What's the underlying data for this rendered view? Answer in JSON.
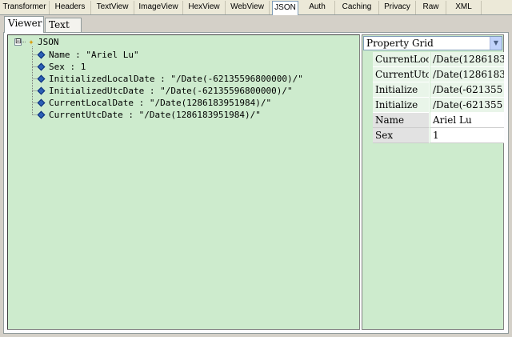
{
  "top_tabs": [
    {
      "label": "Transformer",
      "active": false
    },
    {
      "label": "Headers",
      "active": false
    },
    {
      "label": "TextView",
      "active": false
    },
    {
      "label": "ImageView",
      "active": false
    },
    {
      "label": "HexView",
      "active": false
    },
    {
      "label": "WebView",
      "active": false
    },
    {
      "label": "JSON",
      "active": true
    },
    {
      "label": "Auth",
      "active": false
    },
    {
      "label": "Caching",
      "active": false
    },
    {
      "label": "Privacy",
      "active": false
    },
    {
      "label": "Raw",
      "active": false
    },
    {
      "label": "XML",
      "active": false
    }
  ],
  "sub_tabs": [
    {
      "label": "Viewer",
      "active": true
    },
    {
      "label": "Text",
      "active": false
    }
  ],
  "tree": {
    "root_label": "JSON",
    "expander": "⊟",
    "root_icon": "json-root-icon",
    "nodes": [
      {
        "label": "Name : \"Ariel Lu\""
      },
      {
        "label": "Sex : 1"
      },
      {
        "label": "InitializedLocalDate : \"/Date(-62135596800000)/\""
      },
      {
        "label": "InitializedUtcDate : \"/Date(-62135596800000)/\""
      },
      {
        "label": "CurrentLocalDate : \"/Date(1286183951984)/\""
      },
      {
        "label": "CurrentUtcDate : \"/Date(1286183951984)/\""
      }
    ]
  },
  "property_grid": {
    "header": "Property Grid",
    "rows": [
      {
        "key": "CurrentLoc",
        "value": "/Date(1286183",
        "readonly": false
      },
      {
        "key": "CurrentUtc",
        "value": "/Date(1286183",
        "readonly": false
      },
      {
        "key": "Initialize",
        "value": "/Date(-621355",
        "readonly": false
      },
      {
        "key": "Initialize",
        "value": "/Date(-621355",
        "readonly": false
      },
      {
        "key": "Name",
        "value": "Ariel Lu",
        "readonly": true
      },
      {
        "key": "Sex",
        "value": "1",
        "readonly": true
      }
    ]
  },
  "colors": {
    "panel_bg": "#cdebcd",
    "diamond": "#2b5fb4",
    "tab_strip": "#ece9d8"
  }
}
